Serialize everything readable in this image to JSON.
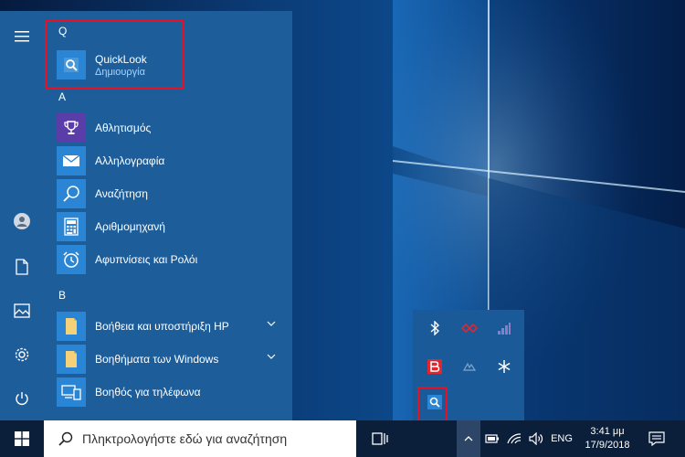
{
  "start_menu": {
    "groups": [
      {
        "letter": "Q",
        "apps": [
          {
            "label": "QuickLook",
            "sub": "Δημιουργία",
            "icon": "quicklook-icon"
          }
        ]
      },
      {
        "letter": "A",
        "apps": [
          {
            "label": "Αθλητισμός",
            "icon": "trophy-icon"
          },
          {
            "label": "Αλληλογραφία",
            "icon": "mail-icon"
          },
          {
            "label": "Αναζήτηση",
            "icon": "search-icon"
          },
          {
            "label": "Αριθμομηχανή",
            "icon": "calculator-icon"
          },
          {
            "label": "Αφυπνίσεις και Ρολόι",
            "icon": "alarm-clock-icon"
          }
        ]
      },
      {
        "letter": "B",
        "apps": [
          {
            "label": "Βοήθεια και υποστήριξη HP",
            "icon": "folder-icon",
            "expandable": true
          },
          {
            "label": "Βοηθήματα των Windows",
            "icon": "folder-icon",
            "expandable": true
          },
          {
            "label": "Βοηθός για τηλέφωνα",
            "icon": "phone-companion-icon"
          }
        ]
      }
    ],
    "rail_icons": [
      "hamburger-menu-icon",
      "user-avatar-icon",
      "documents-icon",
      "pictures-icon",
      "settings-icon",
      "power-icon"
    ]
  },
  "tray_flyout": {
    "icons": [
      "bluetooth-icon",
      "red-app-icon",
      "network-activity-icon",
      "red-b-icon",
      "device-icon",
      "snowflake-icon",
      "quicklook-tray-icon"
    ]
  },
  "taskbar": {
    "search_placeholder": "Πληκτρολογήστε εδώ για αναζήτηση",
    "language": "ENG",
    "time": "3:41 μμ",
    "date": "17/9/2018"
  },
  "colors": {
    "start_bg": "#1d5e9a",
    "highlight": "#e81123",
    "tile_quicklook": "#2a86d4",
    "tile_trophy": "#5a3da8",
    "tile_default": "#2a86d4",
    "taskbar_bg": "#0c1f3a"
  }
}
